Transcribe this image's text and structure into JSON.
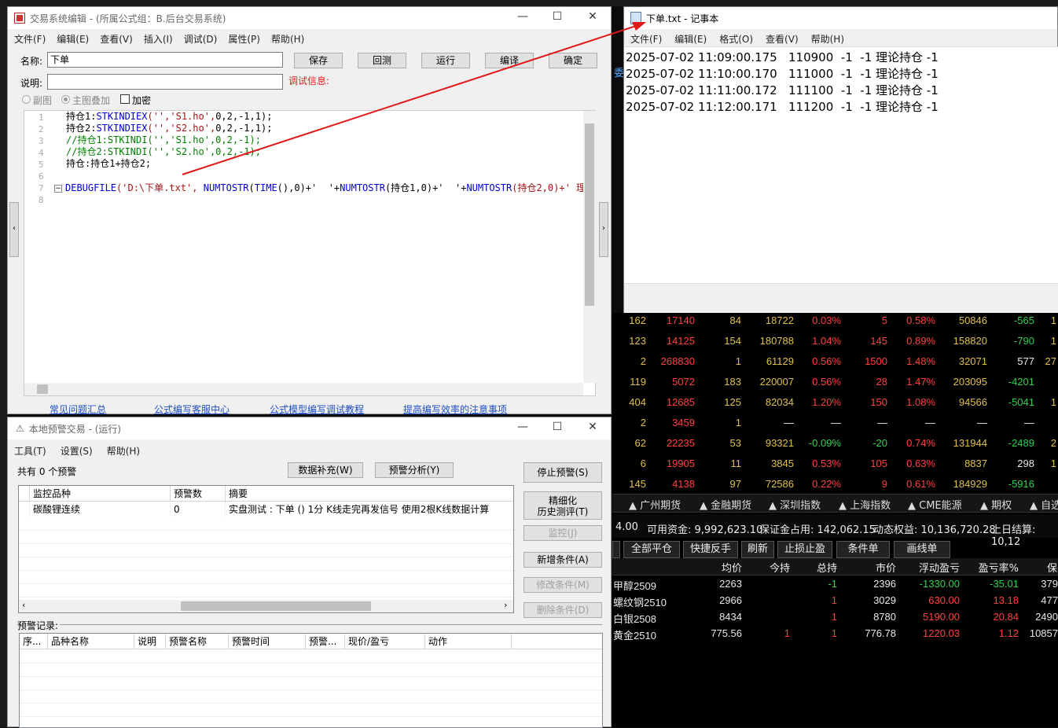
{
  "editor": {
    "title": "交易系统编辑 - (所属公式组：B.后台交易系统)",
    "menu": [
      "文件(F)",
      "编辑(E)",
      "查看(V)",
      "插入(I)",
      "调试(D)",
      "属性(P)",
      "帮助(H)"
    ],
    "name_label": "名称:",
    "name_value": "下单",
    "desc_label": "说明:",
    "desc_value": "",
    "debug_label": "调试信息:",
    "buttons": {
      "save": "保存",
      "review": "回测",
      "run": "运行",
      "compile": "编译",
      "ok": "确定"
    },
    "radio_sub": "副图",
    "radio_main": "主图叠加",
    "check_encrypt": "加密",
    "line_numbers": [
      "1",
      "2",
      "3",
      "4",
      "5",
      "6",
      "7",
      "8"
    ],
    "code": {
      "l1a": "持仓1:",
      "l1b": "STKINDIEX",
      "l1c": "('','S1.ho',",
      "l1d": "0,2,-1,1);",
      "l2a": "持仓2:",
      "l2b": "STKINDIEX",
      "l2c": "('','S2.ho',",
      "l2d": "0,2,-1,1);",
      "l3": "//持仓1:STKINDI('','S1.ho',0,2,-1);",
      "l4": "//持仓2:STKINDI('','S2.ho',0,2,-1);",
      "l5": "持仓:持仓1+持仓2;",
      "l7a": "DEBUGFILE",
      "l7b": "('D:\\下单.txt', ",
      "l7c": "NUMTOSTR",
      "l7d": "(",
      "l7e": "TIME",
      "l7f": "(),0)+'  '+",
      "l7g": "NUMTOSTR",
      "l7h": "(持仓1,0)+'  '+",
      "l7i": "NUMTOSTR",
      "l7j": "(持仓2,0)+' 理"
    },
    "links": [
      "常见问题汇总",
      "公式编写客服中心",
      "公式模型编写调试教程",
      "提高编写效率的注意事项"
    ]
  },
  "alert": {
    "title": "本地预警交易 - (运行)",
    "menu": [
      "工具(T)",
      "设置(S)",
      "帮助(H)"
    ],
    "count_text": "共有 0 个预警",
    "btn_data": "数据补充(W)",
    "btn_analysis": "预警分析(Y)",
    "btn_stop": "停止预警(S)",
    "btn_refine_1": "精细化",
    "btn_refine_2": "历史测评(T)",
    "btn_monitor": "监控(J)",
    "btn_add": "新增条件(A)",
    "btn_modify": "修改条件(M)",
    "btn_delete": "删除条件(D)",
    "grid_headers": [
      "监控品种",
      "预警数",
      "摘要"
    ],
    "grid_row": [
      "碳酸锂连续",
      "0",
      "实盘测试 : 下单 () 1分 K线走完再发信号 使用2根K线数据计算"
    ],
    "records_label": "预警记录:",
    "record_headers": [
      "序...",
      "品种名称",
      "说明",
      "预警名称",
      "预警时间",
      "预警...",
      "现价/盈亏",
      "动作"
    ]
  },
  "notepad": {
    "title": "下单.txt - 记事本",
    "menu": [
      "文件(F)",
      "编辑(E)",
      "格式(O)",
      "查看(V)",
      "帮助(H)"
    ],
    "lines": [
      "2025-07-02 11:09:00.175   110900  -1  -1 理论持仓 -1",
      "2025-07-02 11:10:00.170   111000  -1  -1 理论持仓 -1",
      "2025-07-02 11:11:00.172   111100  -1  -1 理论持仓 -1",
      "2025-07-02 11:12:00.171   111200  -1  -1 理论持仓 -1"
    ]
  },
  "market": {
    "side_label": "委",
    "rows": [
      [
        "162",
        "17140",
        "84",
        "18722",
        "0.03%",
        "5",
        "0.58%",
        "50846",
        "-565",
        "1"
      ],
      [
        "123",
        "14125",
        "154",
        "180788",
        "1.04%",
        "145",
        "0.89%",
        "158820",
        "-790",
        "1"
      ],
      [
        "2",
        "268830",
        "1",
        "61129",
        "0.56%",
        "1500",
        "1.48%",
        "32071",
        "577",
        "27"
      ],
      [
        "119",
        "5072",
        "183",
        "220007",
        "0.56%",
        "28",
        "1.47%",
        "203095",
        "-4201",
        ""
      ],
      [
        "404",
        "12685",
        "125",
        "82034",
        "1.20%",
        "150",
        "1.08%",
        "94566",
        "-5041",
        "1"
      ],
      [
        "2",
        "3459",
        "1",
        "—",
        "—",
        "—",
        "—",
        "—",
        "—",
        ""
      ],
      [
        "62",
        "22235",
        "53",
        "93321",
        "-0.09%",
        "-20",
        "0.74%",
        "131944",
        "-2489",
        "2"
      ],
      [
        "6",
        "19905",
        "11",
        "3845",
        "0.53%",
        "105",
        "0.63%",
        "8837",
        "298",
        "1"
      ],
      [
        "145",
        "4138",
        "97",
        "72586",
        "0.22%",
        "9",
        "0.61%",
        "184929",
        "-5916",
        ""
      ]
    ],
    "tabs": [
      "广州期货",
      "金融期货",
      "深圳指数",
      "上海指数",
      "CME能源",
      "期权",
      "自选"
    ],
    "account": {
      "a": "4.00",
      "b": "可用资金: 9,992,623.10",
      "c": "保证金占用: 142,062.15",
      "d": "动态权益: 10,136,720.28",
      "e": "上日结算: 10,12"
    },
    "actions": [
      "全部平仓",
      "快捷反手",
      "刷新",
      "止损止盈",
      "条件单",
      "画线单"
    ],
    "pos_headers": [
      "均价",
      "今持",
      "总持",
      "市价",
      "浮动盈亏",
      "盈亏率%",
      "保"
    ],
    "positions": [
      [
        "甲醇2509",
        "2263",
        "",
        "-1",
        "2396",
        "-1330.00",
        "-35.01",
        "379"
      ],
      [
        "螺纹钢2510",
        "2966",
        "",
        "1",
        "3029",
        "630.00",
        "13.18",
        "477"
      ],
      [
        "白银2508",
        "8434",
        "",
        "1",
        "8780",
        "5190.00",
        "20.84",
        "2490"
      ],
      [
        "黄金2510",
        "775.56",
        "1",
        "1",
        "776.78",
        "1220.03",
        "1.12",
        "10857"
      ]
    ]
  },
  "colors": {
    "up": "#ff4040",
    "down": "#30d050",
    "neutral": "#e8e8e8",
    "arrow": "#e01818"
  }
}
